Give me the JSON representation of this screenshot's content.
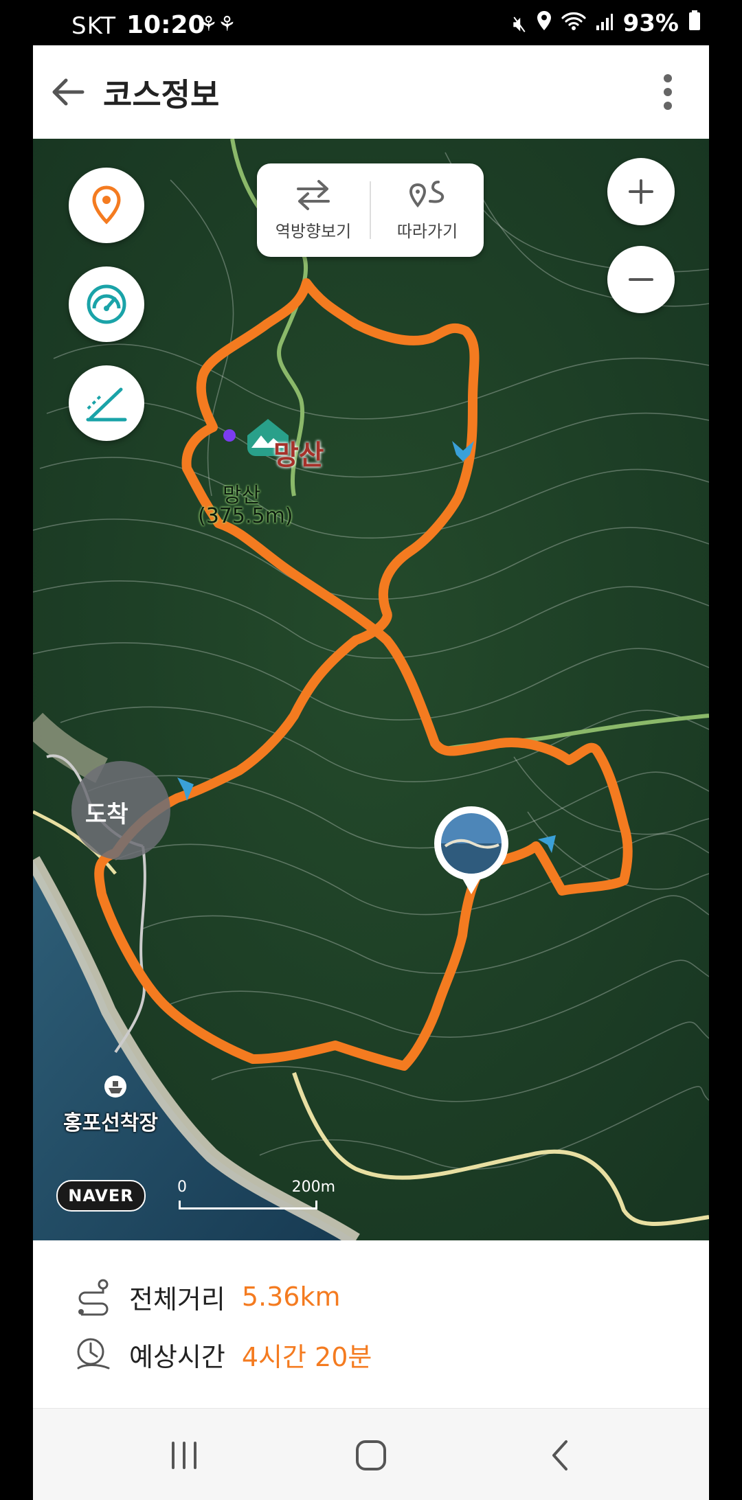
{
  "status": {
    "carrier": "SKT",
    "time": "10:20",
    "battery": "93%",
    "icons": [
      "hiking-notification-icon",
      "hiking-notification-icon",
      "mute-icon",
      "location-icon",
      "wifi-icon",
      "signal-icon",
      "battery-icon"
    ]
  },
  "appbar": {
    "title": "코스정보"
  },
  "map": {
    "reverse_label": "역방향보기",
    "follow_label": "따라가기",
    "peak_name": "망산",
    "peak_label_name": "망산",
    "peak_label_alt": "(375.5m)",
    "finish_label": "도착",
    "ferry_label": "홍포선착장",
    "brand": "NAVER",
    "scale_zero": "0",
    "scale_max": "200m",
    "route_color": "#f47b20"
  },
  "info": {
    "distance_label": "전체거리",
    "distance_value": "5.36km",
    "time_label": "예상시간",
    "time_value": "4시간 20분"
  }
}
